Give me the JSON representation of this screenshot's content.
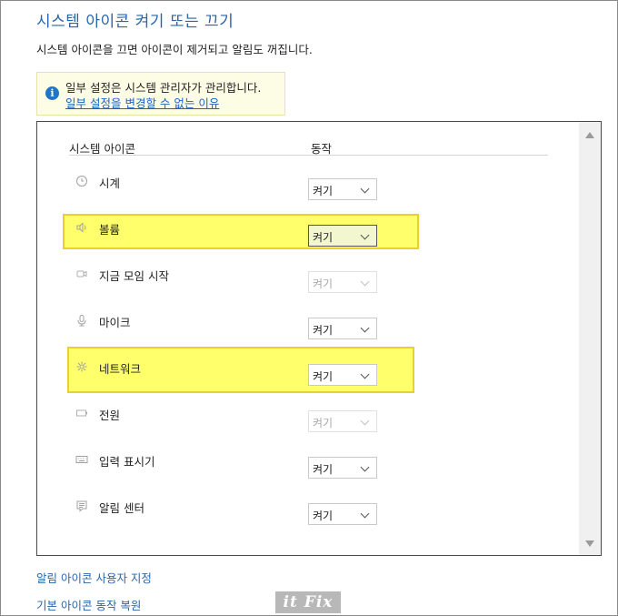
{
  "header": {
    "title": "시스템 아이콘 켜기 또는 끄기",
    "description": "시스템 아이콘을 끄면 아이콘이 제거되고 알림도 꺼집니다."
  },
  "notice": {
    "text": "일부 설정은 시스템 관리자가 관리합니다.",
    "link": "일부 설정을 변경할 수 없는 이유",
    "icon": "info-icon"
  },
  "table": {
    "col_icon": "시스템 아이콘",
    "col_action": "동작",
    "rows": [
      {
        "label": "시계",
        "value": "켜기",
        "icon": "clock-icon",
        "disabled": false,
        "highlighted": false
      },
      {
        "label": "볼륨",
        "value": "켜기",
        "icon": "volume-icon",
        "disabled": false,
        "highlighted": true
      },
      {
        "label": "지금 모임 시작",
        "value": "켜기",
        "icon": "meet-now-icon",
        "disabled": true,
        "highlighted": false
      },
      {
        "label": "마이크",
        "value": "켜기",
        "icon": "microphone-icon",
        "disabled": false,
        "highlighted": false
      },
      {
        "label": "네트워크",
        "value": "켜기",
        "icon": "network-icon",
        "disabled": false,
        "highlighted": true
      },
      {
        "label": "전원",
        "value": "켜기",
        "icon": "power-icon",
        "disabled": true,
        "highlighted": false
      },
      {
        "label": "입력 표시기",
        "value": "켜기",
        "icon": "keyboard-icon",
        "disabled": false,
        "highlighted": false
      },
      {
        "label": "알림 센터",
        "value": "켜기",
        "icon": "action-center-icon",
        "disabled": false,
        "highlighted": false
      }
    ]
  },
  "links": {
    "customize": "알림 아이콘 사용자 지정",
    "restore": "기본 아이콘 동작 복원"
  },
  "watermark": "it Fix",
  "colors": {
    "title": "#2a66a8",
    "link": "#1e63c4",
    "highlight": "#ffff4c",
    "notice_bg": "#fdfde6"
  }
}
